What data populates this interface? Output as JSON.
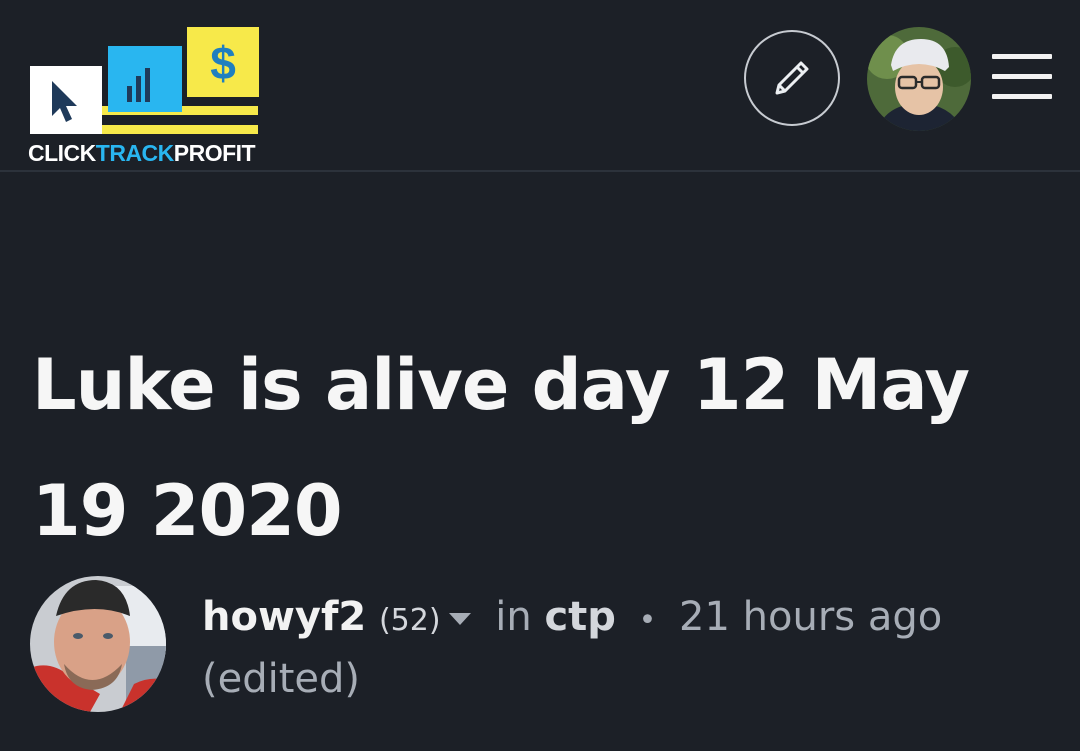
{
  "header": {
    "logo": {
      "word_click": "CLICK",
      "word_track": "TRACK",
      "word_profit": "PROFIT",
      "dollar": "$",
      "colors": {
        "yellow": "#f7e94a",
        "blue": "#29b6f0",
        "dark": "#1f3a5a",
        "white": "#ffffff"
      }
    },
    "edit_icon": "pencil-icon",
    "menu_icon": "hamburger-menu-icon"
  },
  "post": {
    "title": "Luke is alive day 12 May 19 2020",
    "author": "howyf2",
    "reputation": "(52)",
    "in_label": "in",
    "community": "ctp",
    "separator": "•",
    "time": "21 hours ago",
    "edited": "(edited)"
  },
  "colors": {
    "background": "#1c2027",
    "title_text": "#f6f6f6",
    "muted_text": "#a7adb6"
  }
}
